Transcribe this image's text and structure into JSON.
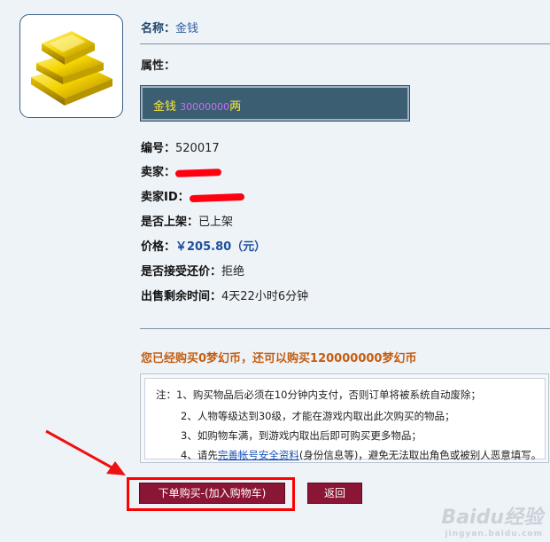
{
  "item": {
    "name_label": "名称：",
    "name_value": "金钱",
    "attr_label": "属性：",
    "attr_gold_label": "金钱",
    "attr_gold_amount": "30000000",
    "attr_gold_unit": "两"
  },
  "details": [
    {
      "label": "编号：",
      "value": "520017"
    },
    {
      "label": "卖家：",
      "value": ""
    },
    {
      "label": "卖家ID：",
      "value": ""
    },
    {
      "label": "是否上架：",
      "value": "已上架"
    },
    {
      "label": "价格：",
      "value": "￥205.80（元）"
    },
    {
      "label": "是否接受还价：",
      "value": "拒绝"
    },
    {
      "label": "出售剩余时间：",
      "value": "4天22小时6分钟"
    }
  ],
  "purchase_status": "您已经购买0梦幻币，还可以购买120000000梦幻币",
  "notice": {
    "line1": "注：1、购买物品后必须在10分钟内支付，否则订单将被系统自动废除；",
    "line2": "2、人物等级达到30级，才能在游戏内取出此次购买的物品；",
    "line3": "3、如购物车满，到游戏内取出后即可购买更多物品；",
    "line4_pre": "4、请先",
    "line4_link": "完善帐号安全资料",
    "line4_post": "(身份信息等)，避免无法取出角色或被别人恶意填写。"
  },
  "buttons": {
    "buy_label": "下单购买-(加入购物车)",
    "back_label": "返回"
  },
  "watermark": {
    "text": "Baidu经验",
    "sub": "jingyan.baidu.com"
  },
  "colors": {
    "page_bg": "#eef3f8",
    "button_bg": "#8b1535",
    "highlight": "#ff0000",
    "status_orange": "#c35f12"
  }
}
